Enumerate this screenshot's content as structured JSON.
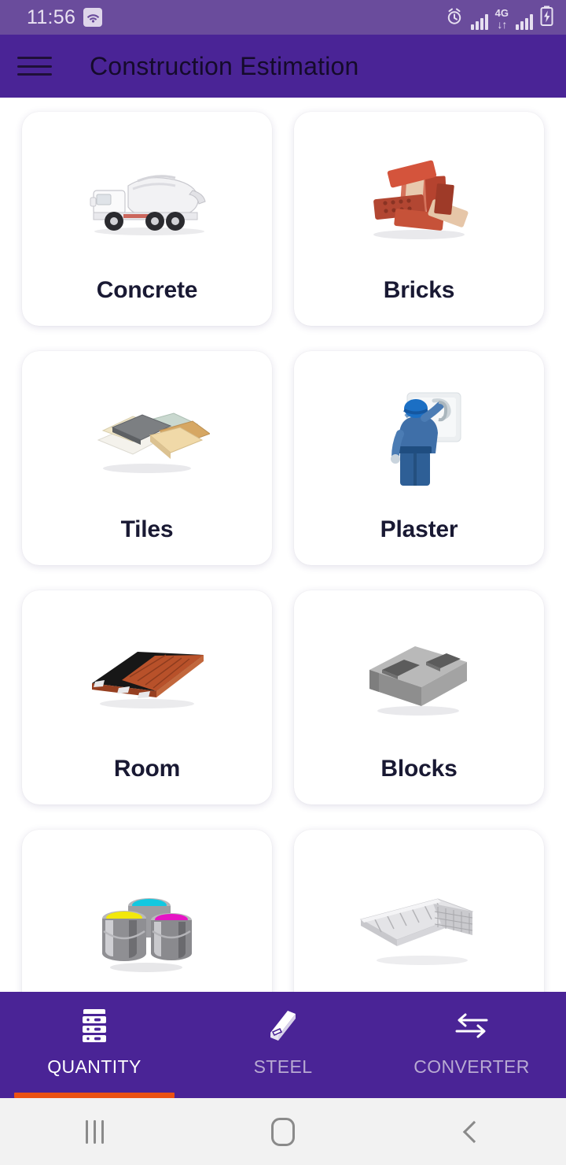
{
  "status_bar": {
    "time": "11:56",
    "wifi_icon": "wifi-icon",
    "alarm_icon": "alarm-clock-icon",
    "network_label": "4G",
    "battery_icon": "battery-charging-icon",
    "background_color": "#6a4c9c"
  },
  "app_bar": {
    "menu_icon": "hamburger-menu-icon",
    "title": "Construction Estimation",
    "background_color": "#4a2496",
    "title_color": "#150b2b"
  },
  "main": {
    "cards": [
      {
        "label": "Concrete",
        "icon": "concrete-mixer-truck-image"
      },
      {
        "label": "Bricks",
        "icon": "brick-pile-image"
      },
      {
        "label": "Tiles",
        "icon": "tile-stack-image"
      },
      {
        "label": "Plaster",
        "icon": "plasterer-worker-image"
      },
      {
        "label": "Room",
        "icon": "wooden-floor-panel-image"
      },
      {
        "label": "Blocks",
        "icon": "concrete-block-image"
      },
      {
        "label": "",
        "icon": "paint-cans-image"
      },
      {
        "label": "",
        "icon": "metal-lath-mesh-image"
      }
    ],
    "card_background": "#ffffff",
    "label_color": "#191933"
  },
  "bottom_tabs": {
    "active_index": 0,
    "indicator_color": "#eb5113",
    "background_color": "#4a2496",
    "items": [
      {
        "label": "QUANTITY",
        "icon": "stacked-units-icon"
      },
      {
        "label": "STEEL",
        "icon": "steel-beam-icon"
      },
      {
        "label": "CONVERTER",
        "icon": "swap-arrows-icon"
      }
    ]
  },
  "system_nav": {
    "recents_icon": "recents-icon",
    "home_icon": "home-icon",
    "back_icon": "back-icon",
    "background_color": "#f2f2f2"
  }
}
